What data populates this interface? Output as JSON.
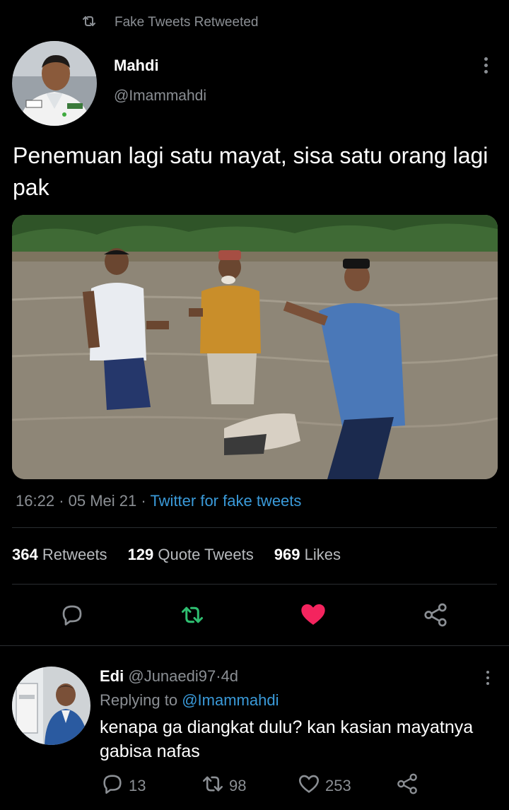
{
  "retweet_header": {
    "label": "Fake Tweets Retweeted"
  },
  "tweet": {
    "author_name": "Mahdi",
    "author_handle": "@Imammahdi",
    "text": "Penemuan lagi satu mayat, sisa satu orang lagi pak",
    "time": "16:22",
    "date": "05 Mei 21",
    "separator": "·",
    "source": "Twitter for fake tweets",
    "stats": {
      "retweets_count": "364",
      "retweets_label": "Retweets",
      "quotes_count": "129",
      "quotes_label": "Quote Tweets",
      "likes_count": "969",
      "likes_label": "Likes"
    },
    "liked": true
  },
  "reply": {
    "author_name": "Edi",
    "author_handle": "@Junaedi97",
    "separator": "·",
    "age": "4d",
    "replying_label": "Replying to",
    "replying_to": "@Imammahdi",
    "text": "kenapa ga diangkat dulu? kan kasian mayatnya gabisa nafas",
    "reply_count": "13",
    "retweet_count": "98",
    "like_count": "253"
  },
  "colors": {
    "background": "#000000",
    "muted": "#8b8f94",
    "link": "#3a9ad9",
    "retweet_green": "#2fbf71",
    "like_pink": "#f4245e"
  },
  "icons": [
    "retweet-icon",
    "more-vertical-icon",
    "reply-icon",
    "like-icon",
    "share-icon"
  ]
}
